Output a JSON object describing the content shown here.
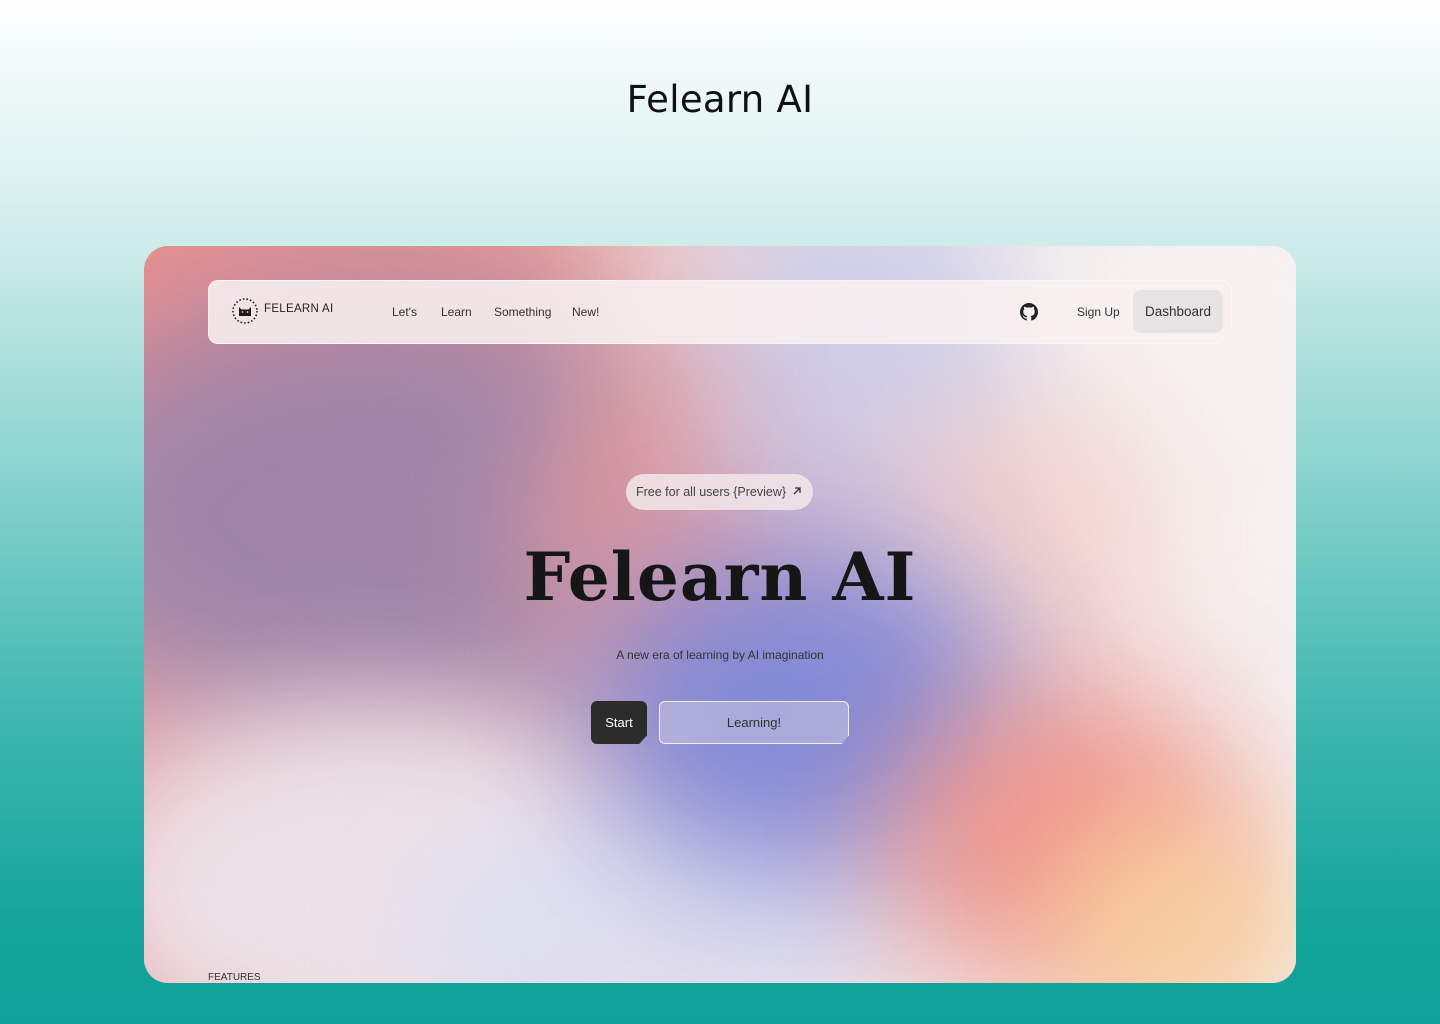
{
  "page": {
    "title": "Felearn AI"
  },
  "nav": {
    "logo_text": "FELEARN  AI",
    "links": [
      "Let's",
      "Learn",
      "Something",
      "New!"
    ],
    "signup": "Sign Up",
    "dashboard": "Dashboard"
  },
  "hero": {
    "badge": "Free for all users {Preview}",
    "title": "Felearn AI",
    "subtitle": "A new era of learning by AI imagination",
    "start": "Start",
    "learning": "Learning!"
  },
  "footer": {
    "features": "FEATURES"
  },
  "colors": {
    "accent_dark": "#2c2c2c",
    "teal_bg": "#14a49c"
  },
  "icons": [
    "cat-logo-icon",
    "github-icon",
    "arrow-up-right-icon"
  ]
}
